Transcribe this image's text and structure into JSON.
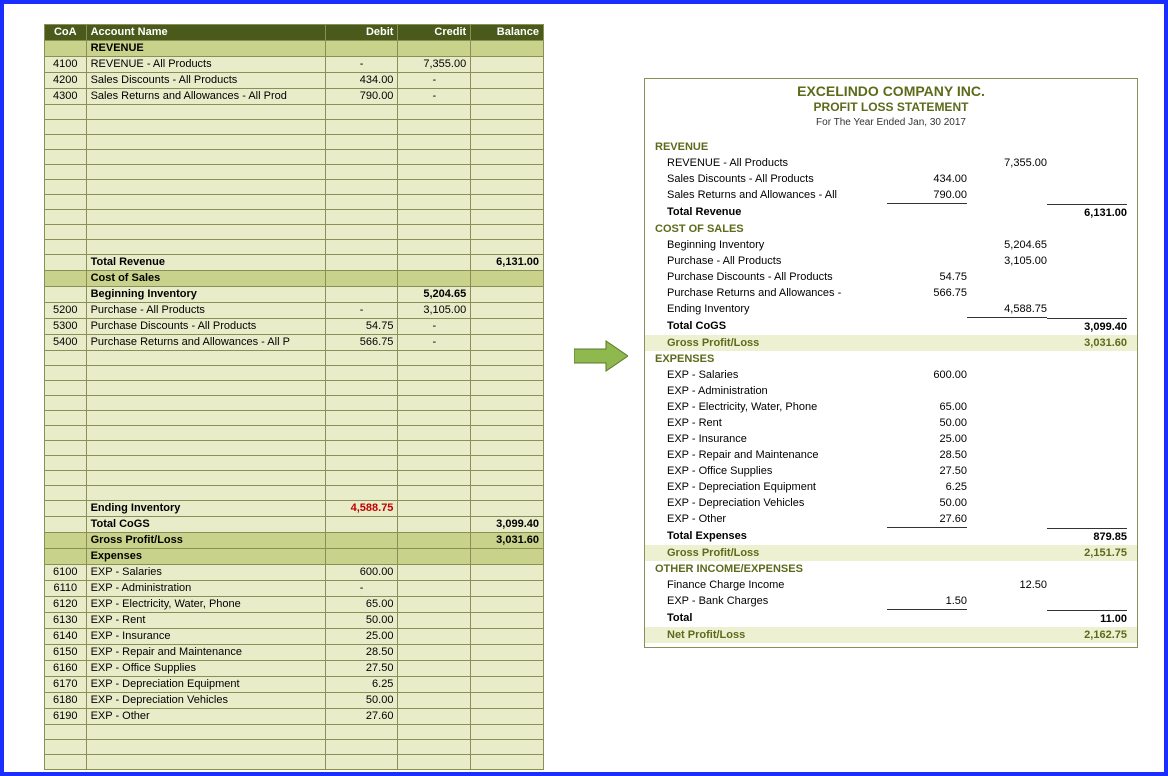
{
  "ledger": {
    "headers": {
      "coa": "CoA",
      "name": "Account Name",
      "debit": "Debit",
      "credit": "Credit",
      "balance": "Balance"
    },
    "sections": {
      "revenue_label": "REVENUE",
      "cost_of_sales_label": "Cost of Sales",
      "beginning_inventory_label": "Beginning Inventory",
      "ending_inventory_label": "Ending Inventory",
      "ending_inventory_debit": "4,588.75",
      "total_revenue_label": "Total Revenue",
      "total_revenue_balance": "6,131.00",
      "total_cogs_label": "Total CoGS",
      "total_cogs_balance": "3,099.40",
      "gross_profit_label": "Gross Profit/Loss",
      "gross_profit_balance": "3,031.60",
      "expenses_label": "Expenses",
      "beginning_inventory_credit": "5,204.65"
    },
    "revenue_rows": [
      {
        "coa": "4100",
        "name": "REVENUE - All Products",
        "debit": "-",
        "credit": "7,355.00"
      },
      {
        "coa": "4200",
        "name": "Sales Discounts - All Products",
        "debit": "434.00",
        "credit": "-"
      },
      {
        "coa": "4300",
        "name": "Sales Returns and Allowances - All Prod",
        "debit": "790.00",
        "credit": "-"
      }
    ],
    "cos_rows": [
      {
        "coa": "5200",
        "name": "Purchase - All Products",
        "debit": "-",
        "credit": "3,105.00"
      },
      {
        "coa": "5300",
        "name": "Purchase Discounts - All Products",
        "debit": "54.75",
        "credit": "-"
      },
      {
        "coa": "5400",
        "name": "Purchase Returns and Allowances - All P",
        "debit": "566.75",
        "credit": "-"
      }
    ],
    "expense_rows": [
      {
        "coa": "6100",
        "name": "EXP - Salaries",
        "debit": "600.00"
      },
      {
        "coa": "6110",
        "name": "EXP - Administration",
        "debit": "-"
      },
      {
        "coa": "6120",
        "name": "EXP - Electricity, Water, Phone",
        "debit": "65.00"
      },
      {
        "coa": "6130",
        "name": "EXP - Rent",
        "debit": "50.00"
      },
      {
        "coa": "6140",
        "name": "EXP - Insurance",
        "debit": "25.00"
      },
      {
        "coa": "6150",
        "name": "EXP - Repair and Maintenance",
        "debit": "28.50"
      },
      {
        "coa": "6160",
        "name": "EXP - Office Supplies",
        "debit": "27.50"
      },
      {
        "coa": "6170",
        "name": "EXP - Depreciation Equipment",
        "debit": "6.25"
      },
      {
        "coa": "6180",
        "name": "EXP - Depreciation Vehicles",
        "debit": "50.00"
      },
      {
        "coa": "6190",
        "name": "EXP - Other",
        "debit": "27.60"
      }
    ]
  },
  "statement": {
    "company": "EXCELINDO COMPANY INC.",
    "title": "PROFIT LOSS STATEMENT",
    "period": "For The Year Ended Jan, 30 2017",
    "labels": {
      "revenue": "REVENUE",
      "total_revenue": "Total Revenue",
      "cost_of_sales": "COST OF SALES",
      "beginning_inventory": "Beginning Inventory",
      "ending_inventory": "Ending Inventory",
      "total_cogs": "Total CoGS",
      "gross_profit": "Gross Profit/Loss",
      "expenses": "EXPENSES",
      "total_expenses": "Total Expenses",
      "other": "OTHER INCOME/EXPENSES",
      "total": "Total",
      "net": "Net Profit/Loss"
    },
    "revenue": [
      {
        "name": "REVENUE - All Products",
        "col2": "7,355.00"
      },
      {
        "name": "Sales Discounts - All Products",
        "col1": "434.00"
      },
      {
        "name": "Sales Returns and Allowances - All",
        "col1": "790.00"
      }
    ],
    "total_revenue": "6,131.00",
    "cos": [
      {
        "name": "Beginning Inventory",
        "col2": "5,204.65"
      },
      {
        "name": "Purchase - All Products",
        "col2": "3,105.00"
      },
      {
        "name": "Purchase Discounts - All Products",
        "col1": "54.75"
      },
      {
        "name": "Purchase Returns and Allowances -",
        "col1": "566.75"
      },
      {
        "name": "Ending Inventory",
        "col2": "4,588.75"
      }
    ],
    "total_cogs": "3,099.40",
    "gross_profit_1": "3,031.60",
    "expenses": [
      {
        "name": "EXP - Salaries",
        "col1": "600.00"
      },
      {
        "name": "EXP - Administration",
        "col1": ""
      },
      {
        "name": "EXP - Electricity, Water, Phone",
        "col1": "65.00"
      },
      {
        "name": "EXP - Rent",
        "col1": "50.00"
      },
      {
        "name": "EXP - Insurance",
        "col1": "25.00"
      },
      {
        "name": "EXP - Repair and Maintenance",
        "col1": "28.50"
      },
      {
        "name": "EXP - Office Supplies",
        "col1": "27.50"
      },
      {
        "name": "EXP - Depreciation Equipment",
        "col1": "6.25"
      },
      {
        "name": "EXP - Depreciation Vehicles",
        "col1": "50.00"
      },
      {
        "name": "EXP - Other",
        "col1": "27.60"
      }
    ],
    "total_expenses": "879.85",
    "gross_profit_2": "2,151.75",
    "other": [
      {
        "name": "Finance Charge Income",
        "col2": "12.50"
      },
      {
        "name": "EXP - Bank Charges",
        "col1": "1.50"
      }
    ],
    "total_other": "11.00",
    "net": "2,162.75"
  }
}
